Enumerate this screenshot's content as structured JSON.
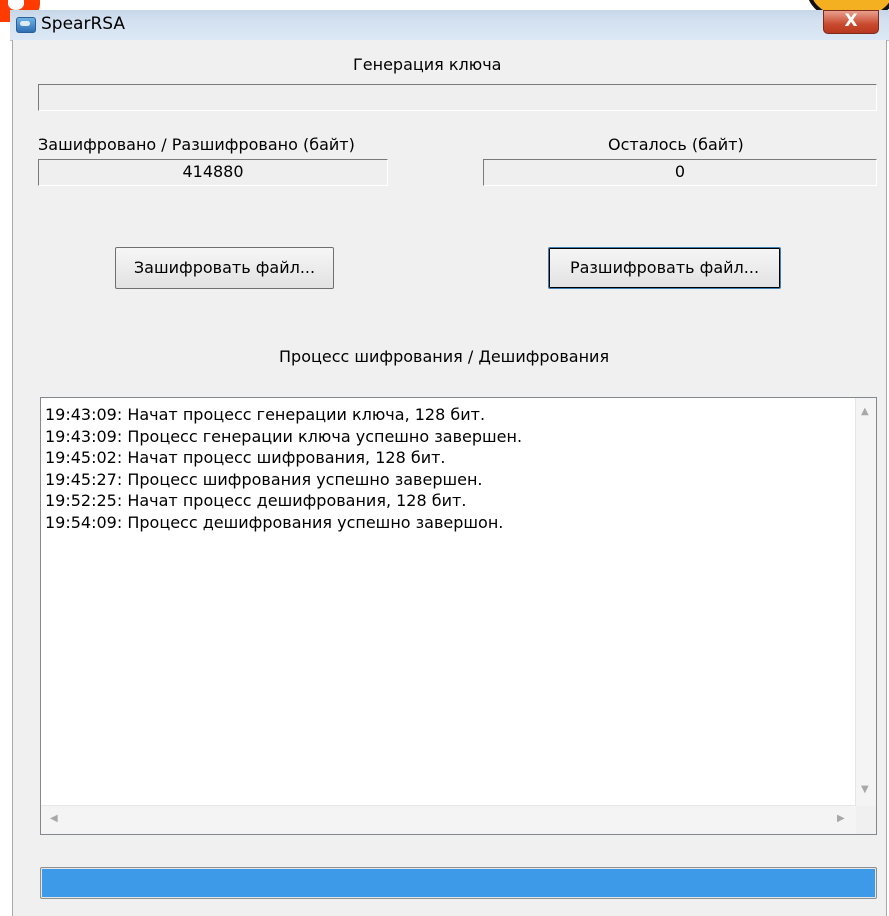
{
  "window": {
    "title": "SpearRSA",
    "close_glyph": "X"
  },
  "key_generation": {
    "label": "Генерация ключа",
    "value": ""
  },
  "encrypted": {
    "label": "Зашифровано / Разшифровано (байт)",
    "value": "414880"
  },
  "remaining": {
    "label": "Осталось (байт)",
    "value": "0"
  },
  "buttons": {
    "encrypt": "Зашифровать файл...",
    "decrypt": "Разшифровать файл..."
  },
  "log": {
    "label": "Процесс шифрования / Дешифрования",
    "lines": [
      "19:43:09: Начат процесс генерации ключа, 128 бит.",
      "19:43:09: Процесс генерации ключа успешно завершен.",
      "19:45:02: Начат процесс шифрования, 128 бит.",
      "19:45:27: Процесс шифрования успешно завершен.",
      "19:52:25: Начат процесс дешифрования, 128 бит.",
      "19:54:09: Процесс дешифрования успешно завершон."
    ]
  },
  "progress": {
    "fraction": 1.0
  },
  "icons": {
    "app": "app-icon",
    "close": "close-icon",
    "scroll_up": "scroll-up-arrow-icon",
    "scroll_down": "scroll-down-arrow-icon",
    "scroll_left": "scroll-left-arrow-icon",
    "scroll_right": "scroll-right-arrow-icon"
  },
  "colors": {
    "progress_fill": "#3c9ae8",
    "close_button": "#c94a2e",
    "titlebar": "#d3e1f0"
  }
}
